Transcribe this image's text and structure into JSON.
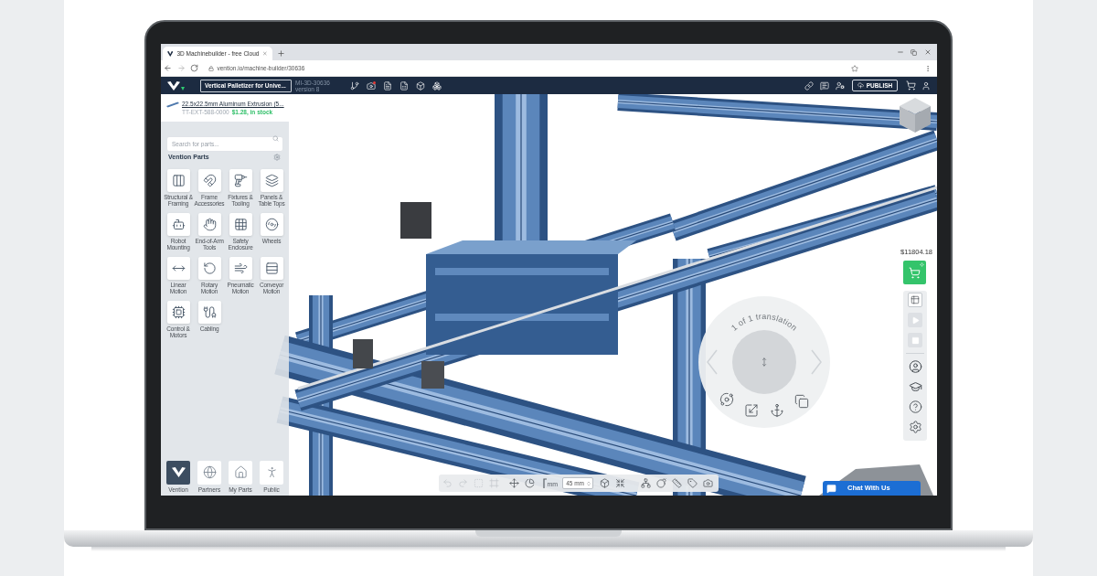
{
  "browser": {
    "tabs": [
      {
        "title": "3D Machinebuilder - free Cloud",
        "selected": true
      }
    ],
    "url": "vention.io/machine-builder/30636"
  },
  "app_bar": {
    "design_name": "Vertical Palletizer for Unive...",
    "design_number": "MI-3D-30636",
    "version": "version 8",
    "publish_label": "PUBLISH"
  },
  "selected_part": {
    "name": "22.5x22.5mm Aluminum Extrusion (5...",
    "part_number": "TT-EXT-588-0000",
    "availability": "$1.28, in stock"
  },
  "parts_panel": {
    "search": {
      "placeholder": "Search for parts..."
    },
    "title": "Vention Parts",
    "categories": [
      {
        "label": "Structural & Framing"
      },
      {
        "label": "Frame Accessories"
      },
      {
        "label": "Fixtures & Tooling"
      },
      {
        "label": "Panels & Table Tops"
      },
      {
        "label": "Robot Mounting"
      },
      {
        "label": "End-of-Arm Tools"
      },
      {
        "label": "Safety Enclosure"
      },
      {
        "label": "Wheels"
      },
      {
        "label": "Linear Motion"
      },
      {
        "label": "Rotary Motion"
      },
      {
        "label": "Pneumatic Motion"
      },
      {
        "label": "Conveyor Motion"
      },
      {
        "label": "Control & Motors"
      },
      {
        "label": "Cabling"
      }
    ]
  },
  "library_tabs": [
    {
      "label": "Vention",
      "selected": true
    },
    {
      "label": "Partners",
      "selected": false
    },
    {
      "label": "My Parts",
      "selected": false
    },
    {
      "label": "Public",
      "selected": false
    }
  ],
  "cart": {
    "total": "$11804.18"
  },
  "simulation_controls": {
    "play": {
      "disabled": true
    },
    "stop": {
      "disabled": true
    }
  },
  "transform_menu": {
    "title": "1 of 1 translation",
    "previous": {
      "disabled": true
    },
    "next": {
      "disabled": true
    }
  },
  "bottom_toolbar": {
    "view_tools": [
      {
        "disabled": true
      },
      {
        "disabled": true
      },
      {
        "disabled": true
      },
      {
        "disabled": true
      },
      {
        "disabled": false
      },
      {
        "disabled": false
      }
    ],
    "unit": "mm",
    "step_size": "45 mm"
  },
  "chat_button": {
    "label": "Chat With Us"
  }
}
